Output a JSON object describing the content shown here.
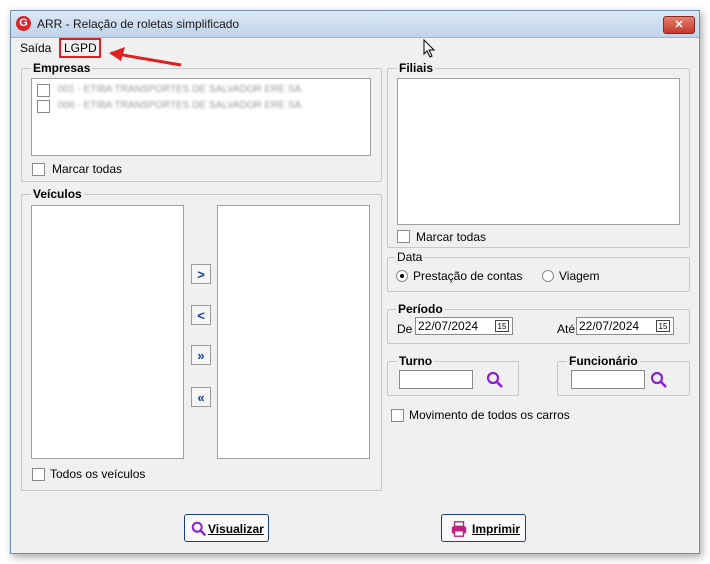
{
  "window": {
    "title": "ARR -  Relação de roletas simplificado",
    "logo_letter": "G",
    "close_glyph": "✕"
  },
  "menu": {
    "items": [
      "Saída",
      "LGPD"
    ]
  },
  "empresas": {
    "title": "Empresas",
    "items": [
      "001 - ETIBA TRANSPORTES DE SALVADOR ERE SA",
      "006 - ETIBA TRANSPORTES DE SALVADOR ERE SA"
    ],
    "mark_all": "Marcar todas"
  },
  "filiais": {
    "title": "Filiais",
    "mark_all": "Marcar todas"
  },
  "veiculos": {
    "title": "Veículos",
    "all_label": "Todos os veículos",
    "buttons": {
      "add": ">",
      "remove": "<",
      "add_all": "»",
      "remove_all": "«"
    }
  },
  "data": {
    "title": "Data",
    "options": [
      "Prestação de contas",
      "Viagem"
    ],
    "selected": "Prestação de contas"
  },
  "periodo": {
    "title": "Período",
    "from_label": "De",
    "from_value": "22/07/2024",
    "to_label": "Até",
    "to_value": "22/07/2024",
    "calendar_glyph": "15"
  },
  "turno": {
    "title": "Turno",
    "value": ""
  },
  "funcionario": {
    "title": "Funcionário",
    "value": ""
  },
  "movimento": {
    "label": "Movimento de todos os carros",
    "checked": false
  },
  "actions": {
    "visualizar": "Visualizar",
    "imprimir": "Imprimir"
  },
  "colors": {
    "accent": "#1b3fa8",
    "search_icon": "#8a1fd0",
    "highlight": "#e02020",
    "print_icon": "#c02080"
  }
}
